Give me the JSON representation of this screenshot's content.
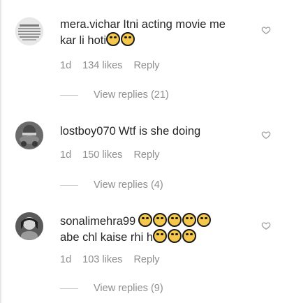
{
  "comments": [
    {
      "username": "mera.vichar",
      "text_line1": "Itni acting movie me",
      "text_line2": "kar li hoti",
      "time": "1d",
      "likes": "134 likes",
      "reply": "Reply",
      "view_replies": "View replies (21)",
      "emoji_count": 2
    },
    {
      "username": "lostboy070",
      "text_line1": "Wtf is she doing",
      "time": "1d",
      "likes": "150 likes",
      "reply": "Reply",
      "view_replies": "View replies (4)"
    },
    {
      "username": "sonalimehra99",
      "text_line2": "abe chl kaise rhi h",
      "time": "1d",
      "likes": "103 likes",
      "reply": "Reply",
      "view_replies": "View replies (9)",
      "emoji_count_line1": 5,
      "emoji_count_line2": 3
    }
  ],
  "icons": {
    "heart": "heart-outline-icon"
  },
  "colors": {
    "text": "#262626",
    "meta": "#8e8e8e",
    "divider": "#c7c7c7"
  }
}
